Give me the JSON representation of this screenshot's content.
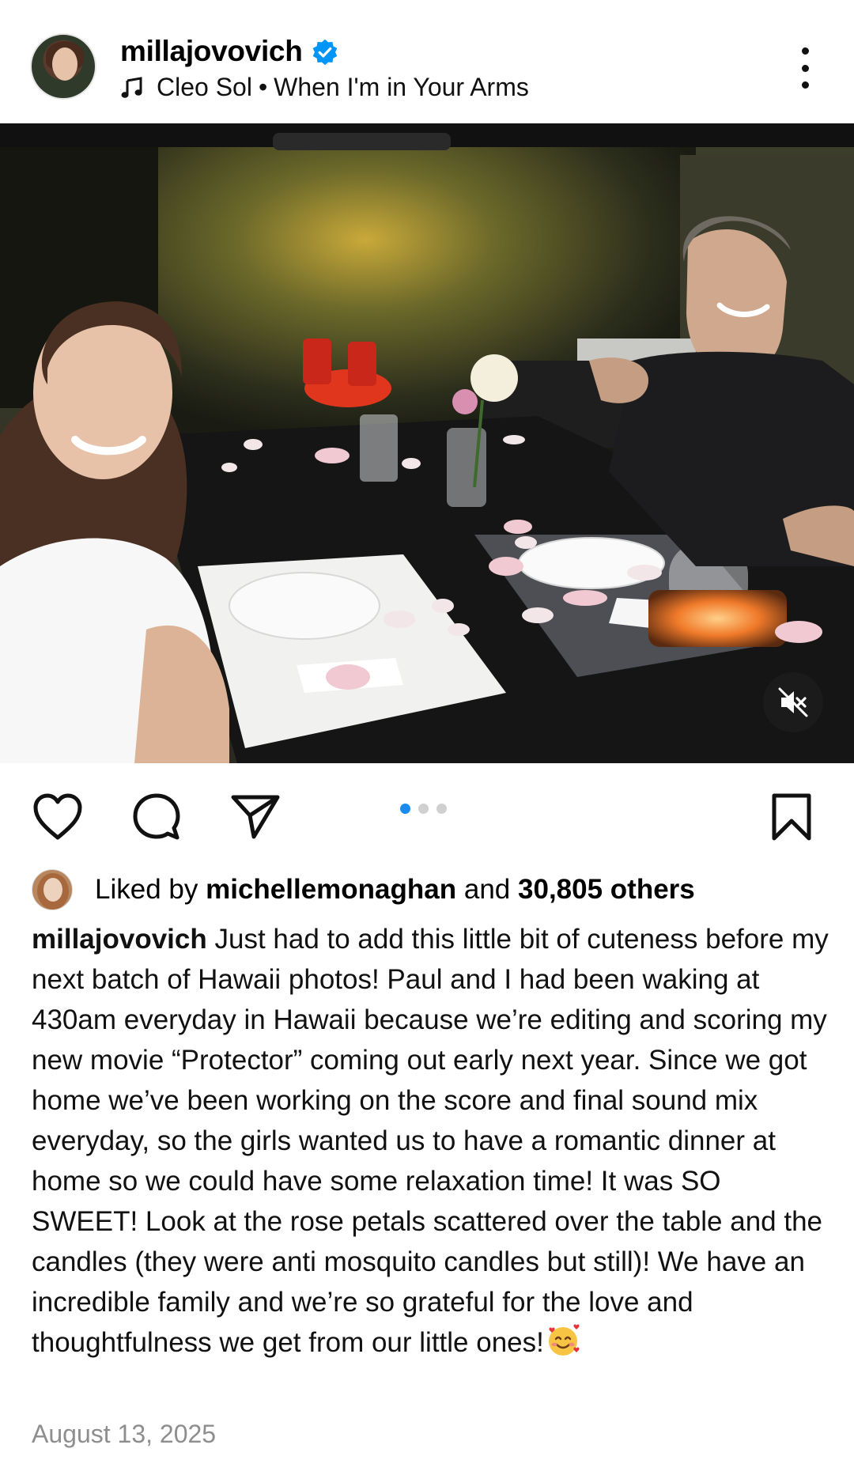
{
  "post": {
    "username": "millajovovich",
    "music": {
      "artist": "Cleo Sol",
      "separator": "•",
      "song": "When I'm in Your Arms"
    },
    "media": {
      "carousel_count": 3,
      "active_index": 0,
      "muted": true
    },
    "likes": {
      "prefix": "Liked by",
      "liker": "michellemonaghan",
      "and": "and",
      "count_text": "30,805 others"
    },
    "caption": {
      "username": "millajovovich",
      "text": "Just had to add this little bit of cuteness before my next batch of Hawaii photos! Paul and I had been waking at 430am everyday in Hawaii because we’re editing and scoring my new movie “Protector” coming out early next year. Since we got home we’ve been working on the score and final sound mix everyday, so the girls wanted us to have a romantic dinner at home so we could have some relaxation time! It was SO SWEET! Look at the rose petals scattered over the table and the candles (they were anti mosquito candles but still)! We have an incredible family and we’re so grateful for the love and thoughtfulness we get from our little ones!",
      "emoji": "smiling-face-with-hearts"
    },
    "date": "August 13, 2025"
  },
  "colors": {
    "verified": "#0095f6",
    "active_dot": "#1a8cf0",
    "muted_text": "#8e8e8e"
  },
  "icons": [
    "verified-badge-icon",
    "music-note-icon",
    "more-options-icon",
    "mute-icon",
    "heart-icon",
    "comment-icon",
    "share-icon",
    "bookmark-icon"
  ]
}
